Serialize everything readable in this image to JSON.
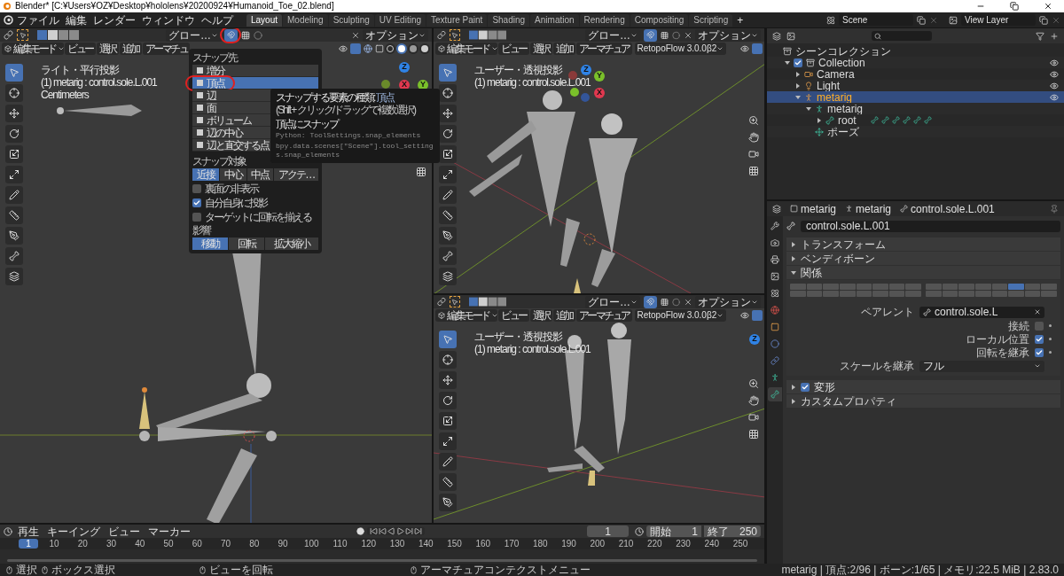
{
  "title_bar": {
    "title": "Blender* [C:¥Users¥OZ¥Desktop¥hololens¥20200924¥Humanoid_Toe_02.blend]"
  },
  "menu_bar": {
    "menus": [
      "ファイル",
      "編集",
      "レンダー",
      "ウィンドウ",
      "ヘルプ"
    ],
    "workspaces": [
      {
        "label": "Layout",
        "selected": true
      },
      {
        "label": "Modeling",
        "selected": false
      },
      {
        "label": "Sculpting",
        "selected": false
      },
      {
        "label": "UV Editing",
        "selected": false
      },
      {
        "label": "Texture Paint",
        "selected": false
      },
      {
        "label": "Shading",
        "selected": false
      },
      {
        "label": "Animation",
        "selected": false
      },
      {
        "label": "Rendering",
        "selected": false
      },
      {
        "label": "Compositing",
        "selected": false
      },
      {
        "label": "Scripting",
        "selected": false
      }
    ],
    "add_tab": "+",
    "scene": "Scene",
    "view_layer": "View Layer"
  },
  "viewports": [
    {
      "orientation": "グロー…",
      "options": "オプション",
      "snap": true,
      "snap_annotated": true,
      "mode": "編集モード",
      "menus": [
        "ビュー",
        "選択",
        "追加",
        "アーマチュ"
      ],
      "view_name": "ライト・平行投影",
      "object_info": "(1) metarig : control.sole.L.001",
      "units": "Centimeters",
      "shading": [
        {
          "kind": "wireframe",
          "selected": false
        },
        {
          "kind": "solid",
          "selected": true
        },
        {
          "kind": "material",
          "selected": false
        },
        {
          "kind": "rendered",
          "selected": false
        }
      ],
      "gizmo": [
        {
          "label": "Z",
          "color": "#2f83e6"
        },
        {
          "label": "X",
          "color": "#e0384f"
        },
        {
          "label": "Y",
          "color": "#7ac02a"
        }
      ],
      "tools": [
        {
          "kind": "select",
          "selected": true
        },
        {
          "kind": "cursor",
          "selected": false
        },
        {
          "kind": "move",
          "selected": false
        },
        {
          "kind": "rotate",
          "selected": false
        },
        {
          "kind": "scale",
          "selected": false
        },
        {
          "kind": "transform",
          "selected": false
        },
        {
          "kind": "annotate",
          "selected": false
        },
        {
          "kind": "measure",
          "selected": false
        },
        {
          "kind": "roll",
          "selected": false
        },
        {
          "kind": "bone_size",
          "selected": false
        },
        {
          "kind": "extrude",
          "selected": false
        }
      ]
    },
    {
      "orientation": "グロー…",
      "options": "オプション",
      "snap": true,
      "snap_annotated": false,
      "mode": "編集モード",
      "menus": [
        "ビュー",
        "選択",
        "追加",
        "アーマチュア"
      ],
      "addon": "RetopoFlow 3.0.0β2",
      "view_name": "ユーザー・透視投影",
      "object_info": "(1) metarig : control.sole.L.001",
      "gizmo": [
        {
          "label": "Z",
          "color": "#2f83e6"
        },
        {
          "label": "Y",
          "color": "#7ac02a"
        },
        {
          "label": "X",
          "color": "#e0384f"
        }
      ],
      "tools": [
        {
          "kind": "select",
          "selected": true
        },
        {
          "kind": "cursor",
          "selected": false
        },
        {
          "kind": "move",
          "selected": false
        },
        {
          "kind": "rotate",
          "selected": false
        },
        {
          "kind": "scale",
          "selected": false
        },
        {
          "kind": "transform",
          "selected": false
        },
        {
          "kind": "annotate",
          "selected": false
        },
        {
          "kind": "measure",
          "selected": false
        },
        {
          "kind": "roll",
          "selected": false
        },
        {
          "kind": "bone_size",
          "selected": false
        },
        {
          "kind": "extrude",
          "selected": false
        }
      ]
    },
    {
      "orientation": "グロー…",
      "options": "オプション",
      "snap": true,
      "snap_annotated": false,
      "mode": "編集モード",
      "menus": [
        "ビュー",
        "選択",
        "追加",
        "アーマチュア"
      ],
      "addon": "RetopoFlow 3.0.0β2",
      "view_name": "ユーザー・透視投影",
      "object_info": "(1) metarig : control.sole.L.001",
      "gizmo": [
        {
          "label": "Z",
          "color": "#2f83e6"
        }
      ],
      "tools": [
        {
          "kind": "select",
          "selected": true
        },
        {
          "kind": "cursor",
          "selected": false
        },
        {
          "kind": "move",
          "selected": false
        },
        {
          "kind": "rotate",
          "selected": false
        },
        {
          "kind": "scale",
          "selected": false
        },
        {
          "kind": "transform",
          "selected": false
        },
        {
          "kind": "annotate",
          "selected": false
        },
        {
          "kind": "measure",
          "selected": false
        },
        {
          "kind": "roll",
          "selected": false
        }
      ]
    }
  ],
  "snap_popup": {
    "title": "スナップ先",
    "elements": [
      {
        "label": "増分",
        "selected": false,
        "annotated": false
      },
      {
        "label": "頂点",
        "selected": true,
        "annotated": true
      },
      {
        "label": "辺",
        "selected": false,
        "annotated": false
      },
      {
        "label": "面",
        "selected": false,
        "annotated": false
      },
      {
        "label": "ボリューム",
        "selected": false,
        "annotated": false
      },
      {
        "label": "辺の中心",
        "selected": false,
        "annotated": false
      },
      {
        "label": "辺と直交する点",
        "selected": false,
        "annotated": false
      }
    ],
    "target_title": "スナップ対象",
    "targets": [
      {
        "label": "近接",
        "selected": true
      },
      {
        "label": "中心",
        "selected": false
      },
      {
        "label": "中点",
        "selected": false
      },
      {
        "label": "アクテ…",
        "selected": false
      }
    ],
    "options": [
      {
        "label": "裏面の非表示",
        "checked": false
      },
      {
        "label": "自分自身に投影",
        "checked": true
      },
      {
        "label": "ターゲットに回転を揃える",
        "checked": false
      }
    ],
    "affect_title": "影響",
    "affect": [
      {
        "label": "移動",
        "selected": true
      },
      {
        "label": "回転",
        "selected": false
      },
      {
        "label": "拡大縮小",
        "selected": false
      }
    ]
  },
  "tooltip": {
    "heading": "スナップする要素の種類:",
    "value": "頂点",
    "hint": "(Shift + クリック/ドラッグで複数選択)",
    "description": "頂点にスナップ",
    "python": [
      "Python: ToolSettings.snap_elements",
      "bpy.data.scenes[\"Scene\"].tool_settings.snap_elements"
    ]
  },
  "outliner": {
    "tree": [
      {
        "label": "シーンコレクション",
        "kind": "scene_collection",
        "selected": false,
        "children": [
          {
            "label": "Collection",
            "kind": "collection",
            "selected": false,
            "expanded": true,
            "checked": true,
            "visible": true,
            "children": [
              {
                "label": "Camera",
                "kind": "camera",
                "selected": false,
                "expanded": false,
                "visible": true
              },
              {
                "label": "Light",
                "kind": "light",
                "selected": false,
                "expanded": false,
                "visible": true
              },
              {
                "label": "metarig",
                "kind": "armature_object",
                "selected": true,
                "expanded": true,
                "visible": true,
                "children": [
                  {
                    "label": "metarig",
                    "kind": "armature",
                    "selected": false,
                    "expanded": true,
                    "children": [
                      {
                        "label": "root",
                        "kind": "bone",
                        "selected": false,
                        "expanded": false
                      }
                    ]
                  },
                  {
                    "label": "ポーズ",
                    "kind": "pose",
                    "selected": false
                  }
                ]
              }
            ]
          }
        ]
      }
    ]
  },
  "properties": {
    "breadcrumb": [
      "metarig",
      "metarig",
      "control.sole.L.001"
    ],
    "bone_name": "control.sole.L.001",
    "tabs": [
      {
        "kind": "tool",
        "selected": false
      },
      {
        "kind": "render",
        "selected": false
      },
      {
        "kind": "output",
        "selected": false
      },
      {
        "kind": "view_layer",
        "selected": false
      },
      {
        "kind": "scene",
        "selected": false
      },
      {
        "kind": "world",
        "selected": false
      },
      {
        "kind": "object",
        "selected": false
      },
      {
        "kind": "physics",
        "selected": false
      },
      {
        "kind": "constraints",
        "selected": false
      },
      {
        "kind": "armature",
        "selected": false
      },
      {
        "kind": "bone",
        "selected": true
      }
    ],
    "panels": [
      {
        "label": "トランスフォーム",
        "expanded": false
      },
      {
        "label": "ベンディボーン",
        "expanded": false
      },
      {
        "label": "関係",
        "expanded": true
      }
    ],
    "layers": [
      [
        {
          "selected": false
        },
        {
          "selected": false
        },
        {
          "selected": false
        },
        {
          "selected": false
        },
        {
          "selected": false
        },
        {
          "selected": false
        },
        {
          "selected": false
        },
        {
          "selected": false
        },
        {
          "selected": false
        },
        {
          "selected": false
        },
        {
          "selected": false
        },
        {
          "selected": false
        },
        {
          "selected": false
        },
        {
          "selected": false
        },
        {
          "selected": false
        },
        {
          "selected": false
        }
      ],
      [
        {
          "selected": false
        },
        {
          "selected": false
        },
        {
          "selected": false
        },
        {
          "selected": false
        },
        {
          "selected": false
        },
        {
          "selected": true
        },
        {
          "selected": false
        },
        {
          "selected": false
        },
        {
          "selected": false
        },
        {
          "selected": false
        },
        {
          "selected": false
        },
        {
          "selected": false
        },
        {
          "selected": false
        },
        {
          "selected": false
        },
        {
          "selected": false
        },
        {
          "selected": false
        }
      ]
    ],
    "parent_label": "ペアレント",
    "parent": "control.sole.L",
    "checks": [
      {
        "label": "接続",
        "checked": false
      },
      {
        "label": "ローカル位置",
        "checked": true
      },
      {
        "label": "回転を継承",
        "checked": true
      }
    ],
    "scale_label": "スケールを継承",
    "scale_value": "フル",
    "panels_after": [
      {
        "label": "変形",
        "expanded": false,
        "checked": true
      },
      {
        "label": "カスタムプロパティ",
        "expanded": false
      }
    ]
  },
  "timeline": {
    "menus": [
      "再生",
      "キーイング",
      "ビュー",
      "マーカー"
    ],
    "current_frame": "1",
    "start_label": "開始",
    "start": "1",
    "end_label": "終了",
    "end": "250",
    "ruler": [
      {
        "label": "1",
        "selected": true
      },
      {
        "label": "10",
        "selected": false
      },
      {
        "label": "20",
        "selected": false
      },
      {
        "label": "30",
        "selected": false
      },
      {
        "label": "40",
        "selected": false
      },
      {
        "label": "50",
        "selected": false
      },
      {
        "label": "60",
        "selected": false
      },
      {
        "label": "70",
        "selected": false
      },
      {
        "label": "80",
        "selected": false
      },
      {
        "label": "90",
        "selected": false
      },
      {
        "label": "100",
        "selected": false
      },
      {
        "label": "110",
        "selected": false
      },
      {
        "label": "120",
        "selected": false
      },
      {
        "label": "130",
        "selected": false
      },
      {
        "label": "140",
        "selected": false
      },
      {
        "label": "150",
        "selected": false
      },
      {
        "label": "160",
        "selected": false
      },
      {
        "label": "170",
        "selected": false
      },
      {
        "label": "180",
        "selected": false
      },
      {
        "label": "190",
        "selected": false
      },
      {
        "label": "200",
        "selected": false
      },
      {
        "label": "210",
        "selected": false
      },
      {
        "label": "220",
        "selected": false
      },
      {
        "label": "230",
        "selected": false
      },
      {
        "label": "240",
        "selected": false
      },
      {
        "label": "250",
        "selected": false
      }
    ]
  },
  "status_bar": {
    "hints": [
      "選択",
      "ボックス選択",
      "ビューを回転",
      "アーマチュアコンテクストメニュー"
    ],
    "stats": "metarig | 頂点:2/96 | ボーン:1/65 | メモリ:22.5 MiB | 2.83.0"
  }
}
